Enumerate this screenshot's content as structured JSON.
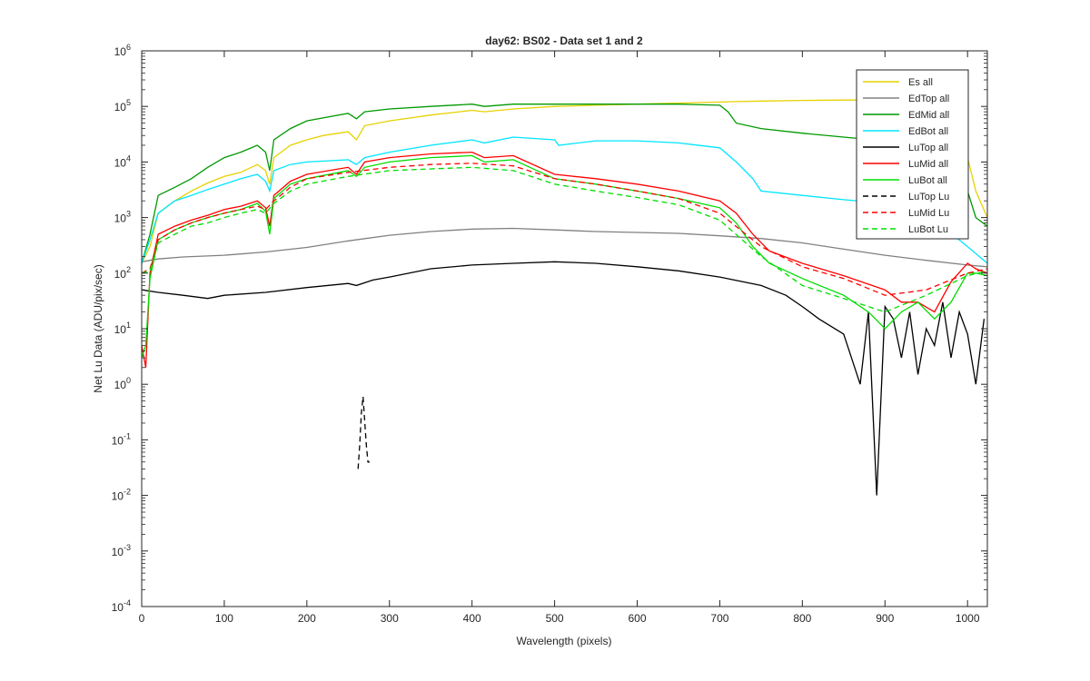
{
  "chart_data": {
    "type": "line",
    "title": "day62: BS02 - Data set 1 and 2",
    "xlabel": "Wavelength (pixels)",
    "ylabel": "Net Lu Data (ADU/pix/sec)",
    "xlim": [
      0,
      1024
    ],
    "ylim": [
      0.0001,
      1000000
    ],
    "yscale": "log",
    "grid": false,
    "legend_position": "top-right",
    "x_ticks": [
      0,
      100,
      200,
      300,
      400,
      500,
      600,
      700,
      800,
      900,
      1000
    ],
    "y_ticks": [
      {
        "value": 0.0001,
        "mantissa": "10",
        "exponent": "-4"
      },
      {
        "value": 0.001,
        "mantissa": "10",
        "exponent": "-3"
      },
      {
        "value": 0.01,
        "mantissa": "10",
        "exponent": "-2"
      },
      {
        "value": 0.1,
        "mantissa": "10",
        "exponent": "-1"
      },
      {
        "value": 1,
        "mantissa": "10",
        "exponent": "0"
      },
      {
        "value": 10,
        "mantissa": "10",
        "exponent": "1"
      },
      {
        "value": 100,
        "mantissa": "10",
        "exponent": "2"
      },
      {
        "value": 1000,
        "mantissa": "10",
        "exponent": "3"
      },
      {
        "value": 10000,
        "mantissa": "10",
        "exponent": "4"
      },
      {
        "value": 100000,
        "mantissa": "10",
        "exponent": "5"
      },
      {
        "value": 1000000,
        "mantissa": "10",
        "exponent": "6"
      }
    ],
    "series": [
      {
        "name": "Es  all",
        "color": "#e6d200",
        "dash": "solid",
        "x": [
          0,
          10,
          20,
          40,
          60,
          80,
          100,
          120,
          140,
          150,
          155,
          160,
          180,
          200,
          220,
          250,
          260,
          270,
          300,
          350,
          400,
          415,
          450,
          500,
          550,
          600,
          650,
          700,
          720,
          750,
          800,
          850,
          900,
          950,
          1000,
          1010,
          1024
        ],
        "y": [
          150,
          300,
          1200,
          2000,
          3000,
          4200,
          5500,
          6500,
          9000,
          7000,
          4000,
          12000,
          20000,
          25000,
          30000,
          35000,
          25000,
          45000,
          55000,
          70000,
          85000,
          80000,
          90000,
          100000,
          105000,
          110000,
          115000,
          120000,
          122000,
          125000,
          128000,
          130000,
          130000,
          130000,
          12000,
          3000,
          1000
        ]
      },
      {
        "name": "EdTop  all",
        "color": "#808080",
        "dash": "solid",
        "x": [
          0,
          20,
          50,
          100,
          150,
          200,
          250,
          300,
          350,
          400,
          450,
          500,
          550,
          600,
          650,
          700,
          750,
          800,
          850,
          900,
          950,
          1000,
          1024
        ],
        "y": [
          160,
          180,
          195,
          210,
          240,
          290,
          380,
          480,
          560,
          620,
          640,
          600,
          560,
          540,
          520,
          470,
          420,
          350,
          270,
          210,
          170,
          140,
          130
        ]
      },
      {
        "name": "EdMid  all",
        "color": "#009900",
        "dash": "solid",
        "x": [
          0,
          10,
          20,
          40,
          60,
          80,
          100,
          120,
          140,
          150,
          155,
          160,
          180,
          200,
          250,
          260,
          270,
          300,
          350,
          400,
          415,
          450,
          500,
          550,
          600,
          650,
          700,
          710,
          720,
          750,
          800,
          850,
          900,
          950,
          1000,
          1010,
          1024
        ],
        "y": [
          150,
          500,
          2500,
          3500,
          5000,
          8000,
          12000,
          15000,
          20000,
          15000,
          7000,
          25000,
          40000,
          55000,
          75000,
          60000,
          80000,
          90000,
          100000,
          110000,
          100000,
          110000,
          110000,
          110000,
          110000,
          110000,
          105000,
          80000,
          50000,
          40000,
          33000,
          28000,
          24000,
          17000,
          3000,
          1000,
          700
        ]
      },
      {
        "name": "EdBot  all",
        "color": "#00e5ff",
        "dash": "solid",
        "x": [
          0,
          10,
          20,
          40,
          60,
          80,
          100,
          120,
          140,
          150,
          155,
          160,
          180,
          200,
          250,
          260,
          270,
          300,
          350,
          400,
          415,
          450,
          500,
          505,
          550,
          600,
          650,
          700,
          720,
          740,
          750,
          800,
          850,
          900,
          950,
          1000,
          1024
        ],
        "y": [
          150,
          400,
          1200,
          2000,
          2500,
          3200,
          4000,
          5000,
          6000,
          4500,
          3000,
          7000,
          9000,
          10000,
          11000,
          9000,
          12000,
          15000,
          20000,
          25000,
          22000,
          28000,
          25000,
          20000,
          24000,
          24000,
          22000,
          18000,
          10000,
          5000,
          3000,
          2500,
          2100,
          1800,
          1200,
          300,
          150
        ]
      },
      {
        "name": "LuTop  all",
        "color": "#000000",
        "dash": "solid",
        "x": [
          0,
          20,
          50,
          80,
          100,
          150,
          200,
          250,
          260,
          280,
          300,
          350,
          400,
          450,
          500,
          550,
          600,
          650,
          700,
          750,
          780,
          800,
          820,
          850,
          870,
          880,
          890,
          900,
          910,
          920,
          930,
          940,
          950,
          960,
          970,
          980,
          990,
          1000,
          1010,
          1020
        ],
        "y": [
          50,
          45,
          40,
          35,
          40,
          45,
          55,
          65,
          60,
          75,
          85,
          120,
          140,
          150,
          160,
          150,
          130,
          110,
          85,
          60,
          40,
          25,
          15,
          8,
          1,
          20,
          0.01,
          25,
          15,
          3,
          20,
          1.5,
          10,
          5,
          30,
          3,
          20,
          8,
          1,
          15
        ]
      },
      {
        "name": "LuMid  all",
        "color": "#ff0000",
        "dash": "solid",
        "x": [
          0,
          5,
          10,
          20,
          40,
          60,
          80,
          100,
          120,
          140,
          150,
          155,
          160,
          180,
          200,
          250,
          260,
          270,
          300,
          350,
          400,
          415,
          450,
          500,
          550,
          600,
          650,
          700,
          720,
          740,
          760,
          800,
          850,
          900,
          920,
          940,
          960,
          980,
          1000,
          1010,
          1024
        ],
        "y": [
          5,
          2,
          100,
          500,
          700,
          900,
          1100,
          1400,
          1600,
          2000,
          1500,
          700,
          2500,
          4500,
          6000,
          8000,
          6000,
          10000,
          12000,
          14000,
          15000,
          12000,
          13000,
          6000,
          5000,
          4000,
          3000,
          2000,
          1200,
          500,
          250,
          150,
          90,
          50,
          30,
          30,
          20,
          70,
          150,
          120,
          100
        ]
      },
      {
        "name": "LuBot  all",
        "color": "#00dd00",
        "dash": "solid",
        "x": [
          0,
          5,
          10,
          20,
          40,
          60,
          80,
          100,
          120,
          140,
          150,
          155,
          160,
          180,
          200,
          250,
          260,
          270,
          300,
          350,
          400,
          415,
          450,
          500,
          550,
          600,
          650,
          700,
          720,
          740,
          760,
          800,
          850,
          880,
          900,
          920,
          940,
          960,
          980,
          1000,
          1010,
          1024
        ],
        "y": [
          3,
          5,
          80,
          400,
          600,
          800,
          1000,
          1200,
          1400,
          1800,
          1300,
          500,
          2200,
          4000,
          5000,
          7000,
          5500,
          8000,
          10000,
          12000,
          13000,
          10000,
          11000,
          5000,
          4000,
          3000,
          2200,
          1500,
          800,
          300,
          150,
          80,
          40,
          20,
          10,
          20,
          30,
          15,
          30,
          100,
          100,
          90
        ]
      },
      {
        "name": "LuTop  Lu",
        "color": "#000000",
        "dash": "dashed",
        "x": [
          262,
          264,
          266,
          268,
          272,
          274,
          276
        ],
        "y": [
          0.03,
          0.08,
          0.3,
          0.6,
          0.08,
          0.04,
          0.04
        ]
      },
      {
        "name": "LuMid  Lu",
        "color": "#ff0000",
        "dash": "dashed",
        "x": [
          0,
          10,
          20,
          40,
          60,
          80,
          100,
          120,
          140,
          150,
          160,
          180,
          200,
          250,
          300,
          350,
          400,
          450,
          500,
          550,
          600,
          650,
          700,
          750,
          800,
          850,
          900,
          950,
          1000,
          1024
        ],
        "y": [
          100,
          120,
          400,
          600,
          800,
          1000,
          1200,
          1400,
          1600,
          1400,
          2000,
          3500,
          5000,
          6500,
          8000,
          9000,
          9500,
          8500,
          5000,
          4000,
          3000,
          2200,
          1200,
          300,
          130,
          80,
          40,
          50,
          100,
          120
        ]
      },
      {
        "name": "LuBot  Lu",
        "color": "#00dd00",
        "dash": "dashed",
        "x": [
          0,
          10,
          20,
          40,
          60,
          80,
          100,
          120,
          140,
          150,
          160,
          180,
          200,
          250,
          300,
          350,
          400,
          450,
          500,
          550,
          600,
          650,
          700,
          750,
          800,
          850,
          900,
          950,
          1000,
          1024
        ],
        "y": [
          100,
          110,
          350,
          500,
          700,
          800,
          1000,
          1200,
          1400,
          1200,
          1800,
          3000,
          4000,
          5500,
          7000,
          7500,
          8000,
          7000,
          4000,
          3000,
          2300,
          1700,
          900,
          200,
          60,
          35,
          20,
          40,
          90,
          110
        ]
      }
    ]
  }
}
